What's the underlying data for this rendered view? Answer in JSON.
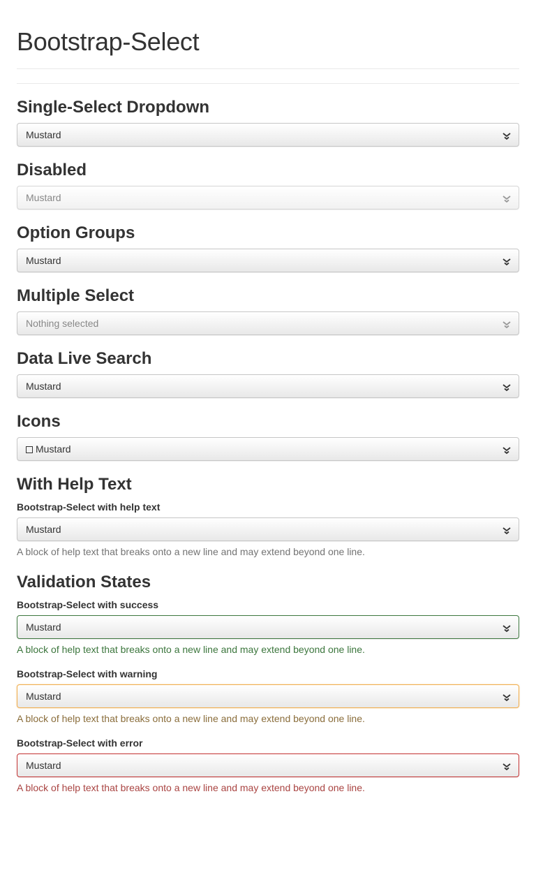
{
  "page": {
    "title": "Bootstrap-Select"
  },
  "sections": {
    "single": {
      "title": "Single-Select Dropdown",
      "value": "Mustard"
    },
    "disabled": {
      "title": "Disabled",
      "value": "Mustard"
    },
    "optgroups": {
      "title": "Option Groups",
      "value": "Mustard"
    },
    "multiple": {
      "title": "Multiple Select",
      "placeholder": "Nothing selected"
    },
    "live_search": {
      "title": "Data Live Search",
      "value": "Mustard"
    },
    "icons": {
      "title": "Icons",
      "value": "Mustard",
      "icon": "empty-square-icon"
    },
    "help_text": {
      "title": "With Help Text",
      "label": "Bootstrap-Select with help text",
      "value": "Mustard",
      "help": "A block of help text that breaks onto a new line and may extend beyond one line."
    },
    "validation": {
      "title": "Validation States",
      "success": {
        "label": "Bootstrap-Select with success",
        "value": "Mustard",
        "help": "A block of help text that breaks onto a new line and may extend beyond one line."
      },
      "warning": {
        "label": "Bootstrap-Select with warning",
        "value": "Mustard",
        "help": "A block of help text that breaks onto a new line and may extend beyond one line."
      },
      "error": {
        "label": "Bootstrap-Select with error",
        "value": "Mustard",
        "help": "A block of help text that breaks onto a new line and may extend beyond one line."
      }
    }
  },
  "colors": {
    "success": "#3c763d",
    "warning": "#f0ad4e",
    "error": "#c23030"
  }
}
